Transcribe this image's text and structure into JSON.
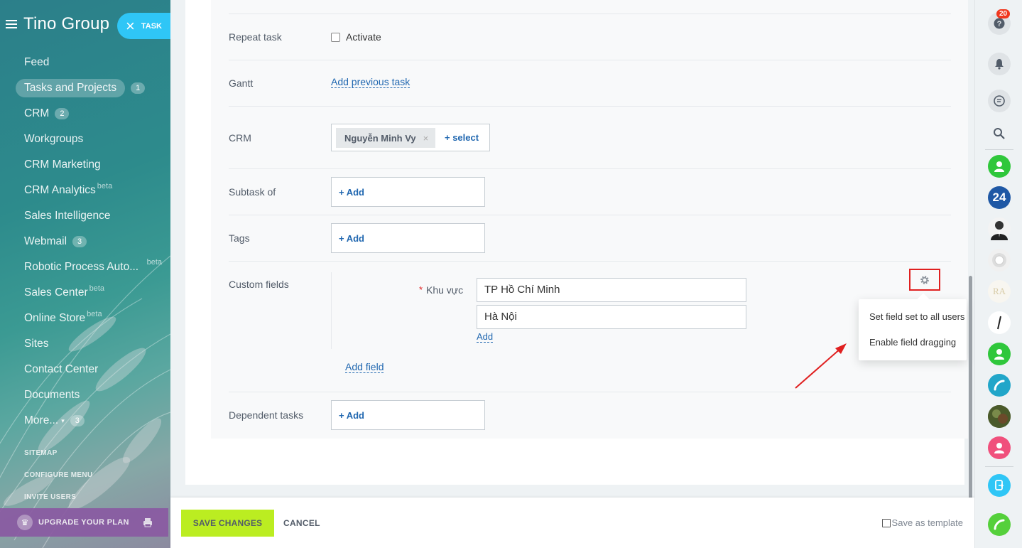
{
  "sidebar": {
    "brand": "Tino Group",
    "task_button": "TASK",
    "items": [
      {
        "label": "Feed",
        "badge": "",
        "beta": ""
      },
      {
        "label": "Tasks and Projects",
        "badge": "1",
        "beta": ""
      },
      {
        "label": "CRM",
        "badge": "2",
        "beta": ""
      },
      {
        "label": "Workgroups",
        "badge": "",
        "beta": ""
      },
      {
        "label": "CRM Marketing",
        "badge": "",
        "beta": ""
      },
      {
        "label": "CRM Analytics",
        "badge": "",
        "beta": "beta"
      },
      {
        "label": "Sales Intelligence",
        "badge": "",
        "beta": ""
      },
      {
        "label": "Webmail",
        "badge": "3",
        "beta": ""
      },
      {
        "label": "Robotic Process Auto...",
        "badge": "",
        "beta": "beta"
      },
      {
        "label": "Sales Center",
        "badge": "",
        "beta": "beta"
      },
      {
        "label": "Online Store",
        "badge": "",
        "beta": "beta"
      },
      {
        "label": "Sites",
        "badge": "",
        "beta": ""
      },
      {
        "label": "Contact Center",
        "badge": "",
        "beta": ""
      },
      {
        "label": "Documents",
        "badge": "",
        "beta": ""
      },
      {
        "label": "More...",
        "badge": "3",
        "beta": ""
      }
    ],
    "links": [
      "SITEMAP",
      "CONFIGURE MENU",
      "INVITE USERS"
    ],
    "upgrade": "UPGRADE YOUR PLAN"
  },
  "form": {
    "repeat_task": {
      "label": "Repeat task",
      "checkbox_label": "Activate"
    },
    "gantt": {
      "label": "Gantt",
      "link": "Add previous task"
    },
    "crm": {
      "label": "CRM",
      "tag": "Nguyễn Minh Vy",
      "tag_remove": "×",
      "select": "+ select"
    },
    "subtask_of": {
      "label": "Subtask of",
      "add": "+ Add"
    },
    "tags": {
      "label": "Tags",
      "add": "+ Add"
    },
    "custom_fields": {
      "label": "Custom fields",
      "field_name": "Khu vực",
      "required_mark": "*",
      "values": [
        "TP Hồ Chí Minh",
        "Hà Nội"
      ],
      "add_value": "Add",
      "add_field": "Add field"
    },
    "dependent_tasks": {
      "label": "Dependent tasks",
      "add": "+ Add"
    }
  },
  "settings_menu": {
    "items": [
      "Set field set to all users",
      "Enable field dragging"
    ]
  },
  "footer": {
    "save": "SAVE CHANGES",
    "cancel": "CANCEL",
    "save_template": "Save as template"
  },
  "rightbar": {
    "help_badge": "20",
    "b24_label": "24"
  },
  "colors": {
    "accent": "#2067b0",
    "save_button": "#bbed21",
    "task_pill": "#2fc6f6",
    "highlight_box": "#e02020"
  }
}
